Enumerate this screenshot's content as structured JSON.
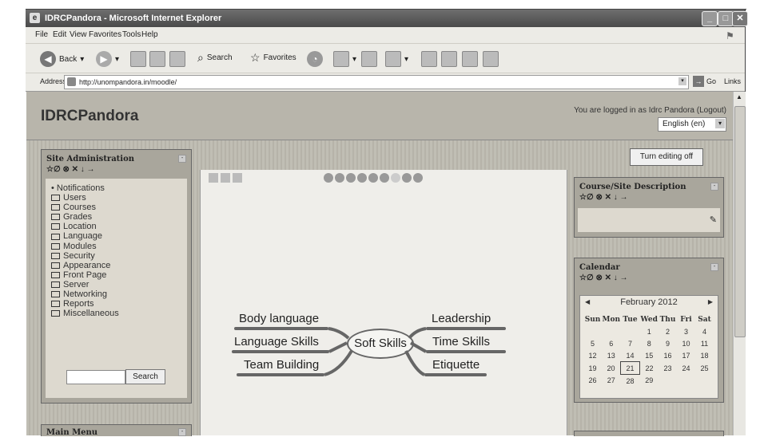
{
  "window": {
    "title": "IDRCPandora - Microsoft Internet Explorer"
  },
  "menu": [
    "File",
    "Edit",
    "View",
    "Favorites",
    "Tools",
    "Help"
  ],
  "toolbar": {
    "back": "Back",
    "search": "Search",
    "favorites": "Favorites"
  },
  "address": {
    "label": "Address",
    "url": "http://unompandora.in/moodle/",
    "go": "Go",
    "links": "Links"
  },
  "site": {
    "title": "IDRCPandora",
    "logged_in": "You are logged in as Idrc Pandora (Logout)",
    "language": "English (en)"
  },
  "admin_block": {
    "title": "Site Administration",
    "icons": "☆∅ ⊗ ✕ ↓ →",
    "items": [
      "Notifications",
      "Users",
      "Courses",
      "Grades",
      "Location",
      "Language",
      "Modules",
      "Security",
      "Appearance",
      "Front Page",
      "Server",
      "Networking",
      "Reports",
      "Miscellaneous"
    ],
    "search_button": "Search"
  },
  "main_menu": {
    "title": "Main Menu"
  },
  "mindmap": {
    "center": "Soft Skills",
    "left": [
      "Body language",
      "Language Skills",
      "Team Building"
    ],
    "right": [
      "Leadership",
      "Time Skills",
      "Etiquette"
    ]
  },
  "edit_button": "Turn editing off",
  "course_block": {
    "title": "Course/Site Description"
  },
  "calendar": {
    "title": "Calendar",
    "month": "February 2012",
    "days": [
      "Sun",
      "Mon",
      "Tue",
      "Wed",
      "Thu",
      "Fri",
      "Sat"
    ],
    "weeks": [
      [
        "",
        "",
        "",
        "1",
        "2",
        "3",
        "4"
      ],
      [
        "5",
        "6",
        "7",
        "8",
        "9",
        "10",
        "11"
      ],
      [
        "12",
        "13",
        "14",
        "15",
        "16",
        "17",
        "18"
      ],
      [
        "19",
        "20",
        "21",
        "22",
        "23",
        "24",
        "25"
      ],
      [
        "26",
        "27",
        "28",
        "29",
        "",
        "",
        ""
      ]
    ],
    "today": "21"
  }
}
